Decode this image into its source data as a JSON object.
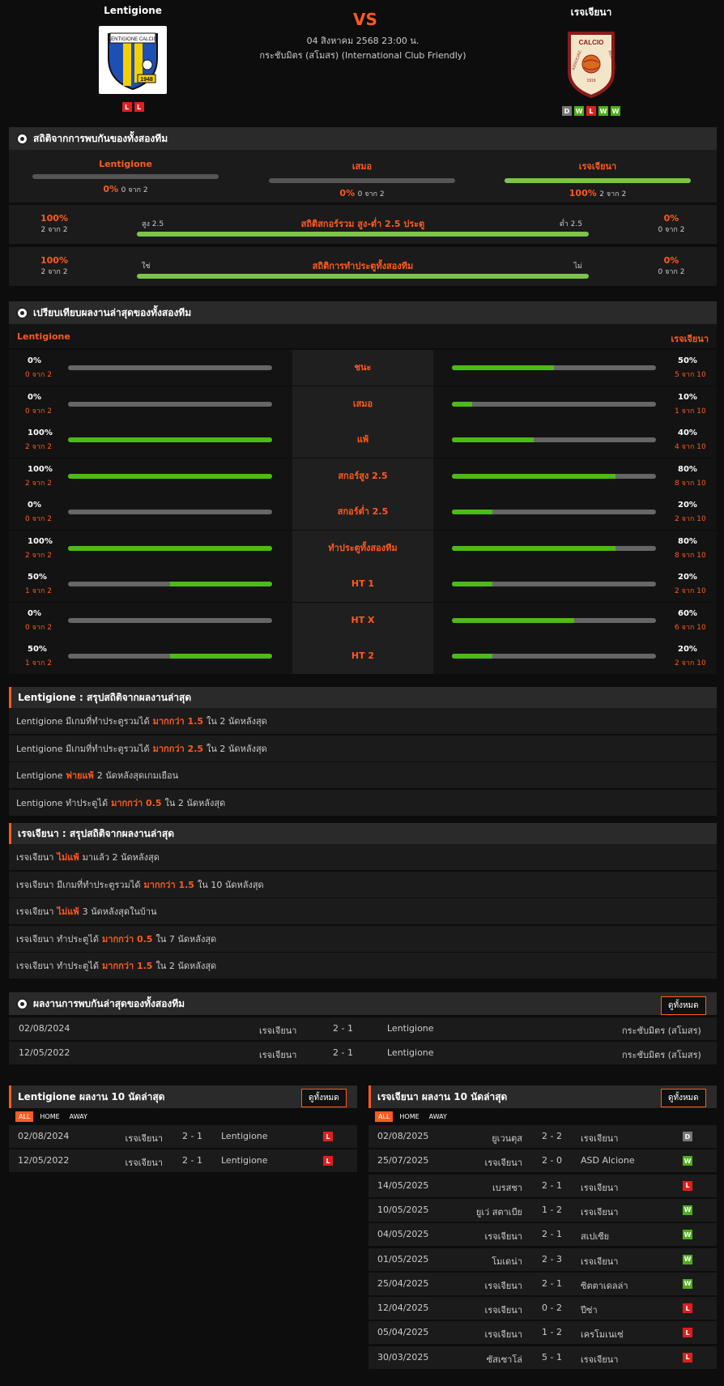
{
  "header": {
    "home": "Lentigione",
    "away": "เรจเจียนา",
    "vs": "VS",
    "datetime": "04 สิงหาคม 2568 23:00 น.",
    "competition": "กระชับมิตร (สโมสร) (International Club Friendly)",
    "home_form": [
      "L",
      "L"
    ],
    "away_form": [
      "D",
      "W",
      "L",
      "W",
      "W"
    ],
    "home_logo_text": "LENTIGIONE CALCIO",
    "home_logo_year": "1948",
    "away_logo_top": "CALCIO",
    "away_logo_left": "ASSOCIAZ.",
    "away_logo_right": "REGGIANA",
    "away_logo_year": "1919"
  },
  "h2h_stats": {
    "title": "สถิติจากการพบกันของทั้งสองทีม",
    "home": {
      "label": "Lentigione",
      "pct": "0%",
      "sub": "0 จาก 2",
      "fill": 0
    },
    "draw": {
      "label": "เสมอ",
      "pct": "0%",
      "sub": "0 จาก 2",
      "fill": 0
    },
    "away": {
      "label": "เรจเจียนา",
      "pct": "100%",
      "sub": "2 จาก 2",
      "fill": 1
    }
  },
  "ou": {
    "left_pct": "100%",
    "left_sub": "2 จาก 2",
    "left_label": "สูง 2.5",
    "title": "สถิติสกอร์รวม สูง-ต่ำ 2.5 ประตู",
    "right_label": "ต่ำ 2.5",
    "right_pct": "0%",
    "right_sub": "0 จาก 2",
    "fill": 1
  },
  "btts": {
    "left_pct": "100%",
    "left_sub": "2 จาก 2",
    "left_label": "ใช่",
    "title": "สถิติการทำประตูทั้งสองทีม",
    "right_label": "ไม่",
    "right_pct": "0%",
    "right_sub": "0 จาก 2",
    "fill": 1
  },
  "compare": {
    "title": "เปรียบเทียบผลงานล่าสุดของทั้งสองทีม",
    "home": "Lentigione",
    "away": "เรจเจียนา",
    "rows": [
      {
        "label": "ชนะ",
        "lp": "0%",
        "ls": "0 จาก 2",
        "lf": 0,
        "rp": "50%",
        "rs": "5 จาก 10",
        "rf": 0.5
      },
      {
        "label": "เสมอ",
        "lp": "0%",
        "ls": "0 จาก 2",
        "lf": 0,
        "rp": "10%",
        "rs": "1 จาก 10",
        "rf": 0.1
      },
      {
        "label": "แพ้",
        "lp": "100%",
        "ls": "2 จาก 2",
        "lf": 1,
        "rp": "40%",
        "rs": "4 จาก 10",
        "rf": 0.4
      },
      {
        "label": "สกอร์สูง 2.5",
        "lp": "100%",
        "ls": "2 จาก 2",
        "lf": 1,
        "rp": "80%",
        "rs": "8 จาก 10",
        "rf": 0.8
      },
      {
        "label": "สกอร์ต่ำ 2.5",
        "lp": "0%",
        "ls": "0 จาก 2",
        "lf": 0,
        "rp": "20%",
        "rs": "2 จาก 10",
        "rf": 0.2
      },
      {
        "label": "ทำประตูทั้งสองทีม",
        "lp": "100%",
        "ls": "2 จาก 2",
        "lf": 1,
        "rp": "80%",
        "rs": "8 จาก 10",
        "rf": 0.8
      },
      {
        "label": "HT 1",
        "lp": "50%",
        "ls": "1 จาก 2",
        "lf": 0.5,
        "rp": "20%",
        "rs": "2 จาก 10",
        "rf": 0.2
      },
      {
        "label": "HT X",
        "lp": "0%",
        "ls": "0 จาก 2",
        "lf": 0,
        "rp": "60%",
        "rs": "6 จาก 10",
        "rf": 0.6
      },
      {
        "label": "HT 2",
        "lp": "50%",
        "ls": "1 จาก 2",
        "lf": 0.5,
        "rp": "20%",
        "rs": "2 จาก 10",
        "rf": 0.2
      }
    ]
  },
  "home_summary": {
    "title": "Lentigione : สรุปสถิติจากผลงานล่าสุด",
    "rows": [
      {
        "a": "Lentigione  มีเกมที่ทำประตูรวมได้",
        "b": "มากกว่า  1.5",
        "c": "ใน 2 นัดหลังสุด"
      },
      {
        "a": "Lentigione  มีเกมที่ทำประตูรวมได้",
        "b": "มากกว่า  2.5",
        "c": "ใน 2 นัดหลังสุด"
      },
      {
        "a": "Lentigione",
        "b": "พ่ายแพ้",
        "c": "2  นัดหลังสุดเกมเยือน"
      },
      {
        "a": "Lentigione  ทำประตูได้",
        "b": "มากกว่า  0.5",
        "c": "ใน 2 นัดหลังสุด"
      }
    ]
  },
  "away_summary": {
    "title": "เรจเจียนา : สรุปสถิติจากผลงานล่าสุด",
    "rows": [
      {
        "a": "เรจเจียนา",
        "b": "ไม่แพ้",
        "c": "มาแล้ว 2 นัดหลังสุด"
      },
      {
        "a": "เรจเจียนา  มีเกมที่ทำประตูรวมได้",
        "b": "มากกว่า  1.5",
        "c": "ใน 10 นัดหลังสุด"
      },
      {
        "a": "เรจเจียนา",
        "b": "ไม่แพ้",
        "c": "3  นัดหลังสุดในบ้าน"
      },
      {
        "a": "เรจเจียนา  ทำประตูได้",
        "b": "มากกว่า  0.5",
        "c": "ใน 7 นัดหลังสุด"
      },
      {
        "a": "เรจเจียนา  ทำประตูได้",
        "b": "มากกว่า  1.5",
        "c": "ใน 2 นัดหลังสุด"
      }
    ]
  },
  "h2h": {
    "title": "ผลงานการพบกันล่าสุดของทั้งสองทีม",
    "view_all": "ดูทั้งหมด",
    "rows": [
      {
        "date": "02/08/2024",
        "home": "เรจเจียนา",
        "score": "2 - 1",
        "away": "Lentigione",
        "comp": "กระชับมิตร (สโมสร)"
      },
      {
        "date": "12/05/2022",
        "home": "เรจเจียนา",
        "score": "2 - 1",
        "away": "Lentigione",
        "comp": "กระชับมิตร (สโมสร)"
      }
    ]
  },
  "home_last": {
    "title": "Lentigione ผลงาน 10 นัดล่าสุด",
    "view_all": "ดูทั้งหมด",
    "tabs": [
      "ALL",
      "HOME",
      "AWAY"
    ],
    "rows": [
      {
        "date": "02/08/2024",
        "home": "เรจเจียนา",
        "score": "2 - 1",
        "away": "Lentigione",
        "res": "L"
      },
      {
        "date": "12/05/2022",
        "home": "เรจเจียนา",
        "score": "2 - 1",
        "away": "Lentigione",
        "res": "L"
      }
    ]
  },
  "away_last": {
    "title": "เรจเจียนา ผลงาน 10 นัดล่าสุด",
    "view_all": "ดูทั้งหมด",
    "tabs": [
      "ALL",
      "HOME",
      "AWAY"
    ],
    "rows": [
      {
        "date": "02/08/2025",
        "home": "ยูเวนตุส",
        "score": "2 - 2",
        "away": "เรจเจียนา",
        "res": "D"
      },
      {
        "date": "25/07/2025",
        "home": "เรจเจียนา",
        "score": "2 - 0",
        "away": "ASD Alcione",
        "res": "W"
      },
      {
        "date": "14/05/2025",
        "home": "เบรสชา",
        "score": "2 - 1",
        "away": "เรจเจียนา",
        "res": "L"
      },
      {
        "date": "10/05/2025",
        "home": "ยูเว่ สตาเบีย",
        "score": "1 - 2",
        "away": "เรจเจียนา",
        "res": "W"
      },
      {
        "date": "04/05/2025",
        "home": "เรจเจียนา",
        "score": "2 - 1",
        "away": "สเปเซีย",
        "res": "W"
      },
      {
        "date": "01/05/2025",
        "home": "โมเดน่า",
        "score": "2 - 3",
        "away": "เรจเจียนา",
        "res": "W"
      },
      {
        "date": "25/04/2025",
        "home": "เรจเจียนา",
        "score": "2 - 1",
        "away": "ซิตตาเดลล่า",
        "res": "W"
      },
      {
        "date": "12/04/2025",
        "home": "เรจเจียนา",
        "score": "0 - 2",
        "away": "ปีซ่า",
        "res": "L"
      },
      {
        "date": "05/04/2025",
        "home": "เรจเจียนา",
        "score": "1 - 2",
        "away": "เครโมเนเซ่",
        "res": "L"
      },
      {
        "date": "30/03/2025",
        "home": "ซัสเซาโล่",
        "score": "5 - 1",
        "away": "เรจเจียนา",
        "res": "L"
      }
    ]
  },
  "colors": {
    "accent": "#ff5a1f",
    "win": "#4caf15",
    "loss": "#e01e1e",
    "draw": "#777777",
    "bar_fill": "#7cc44a"
  }
}
